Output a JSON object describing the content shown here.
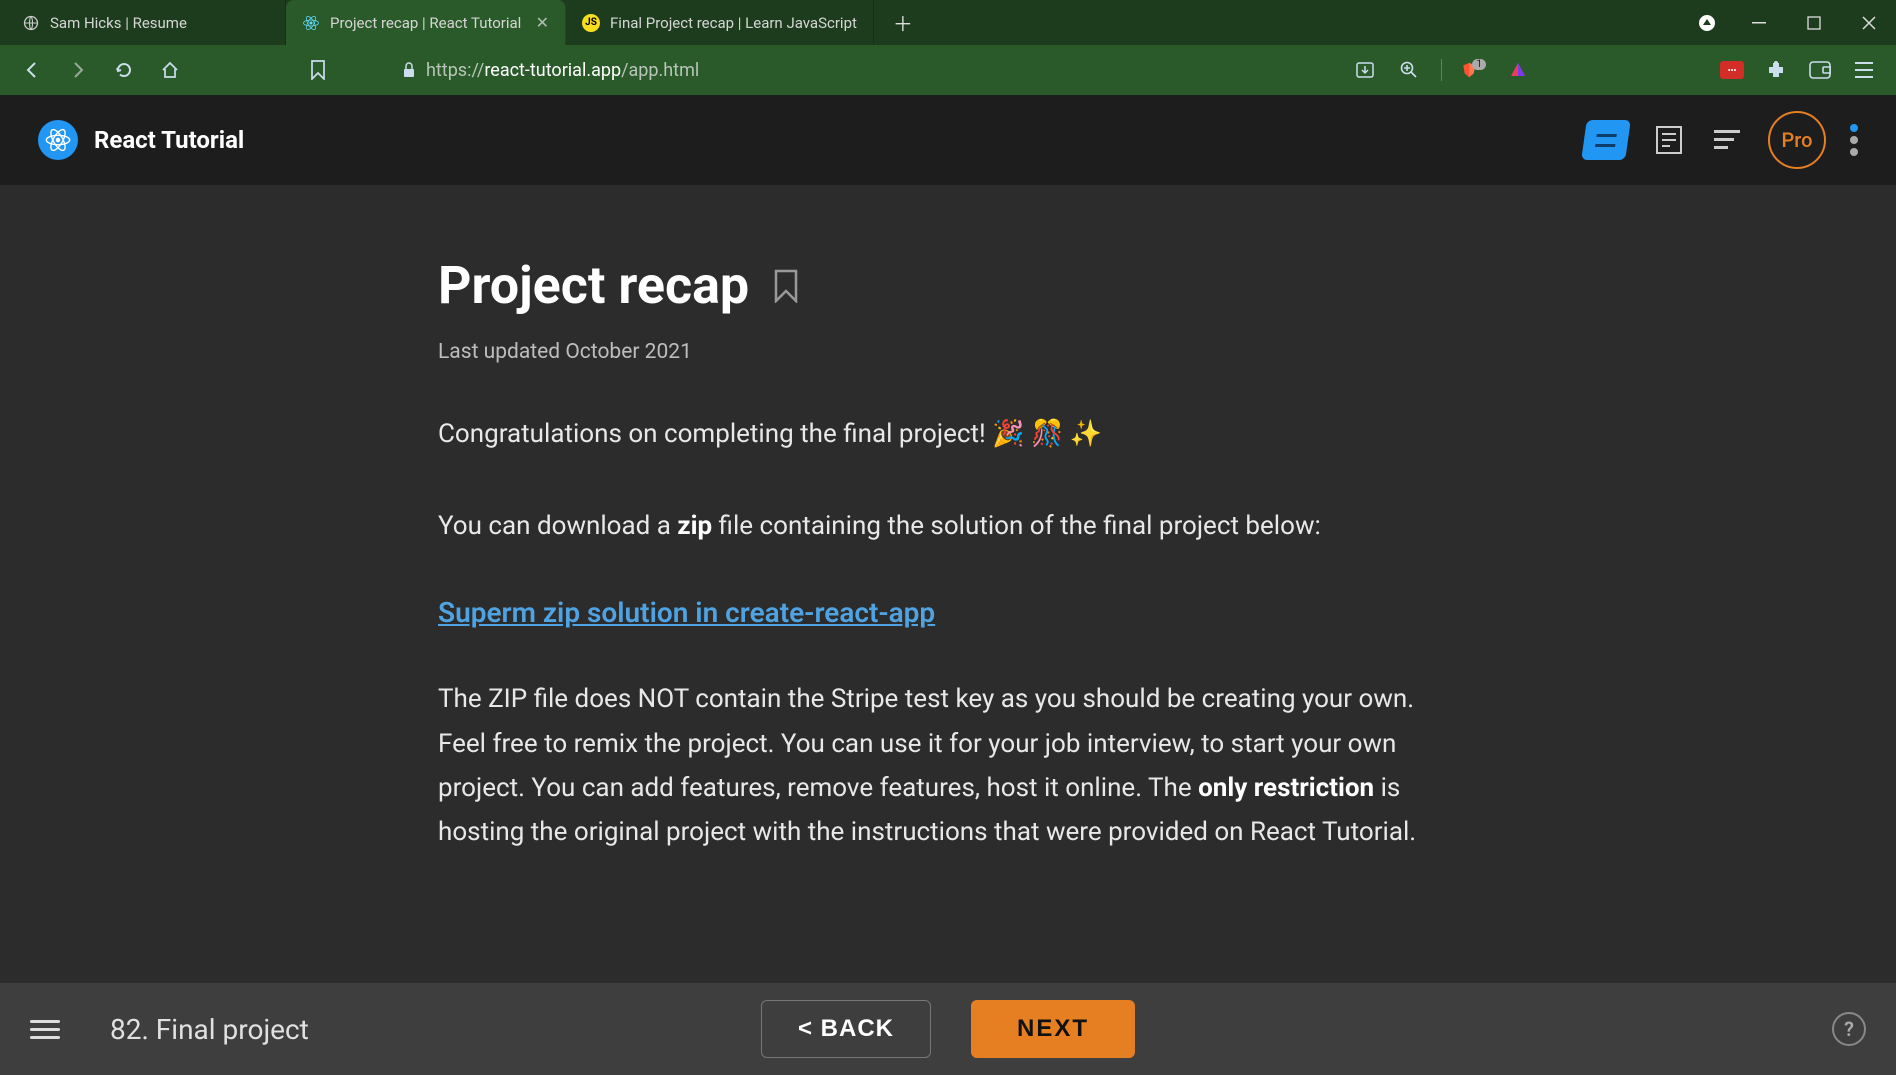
{
  "browser": {
    "tabs": [
      {
        "title": "Sam Hicks | Resume",
        "active": false
      },
      {
        "title": "Project recap | React Tutorial",
        "active": true
      },
      {
        "title": "Final Project recap | Learn JavaScript",
        "active": false
      }
    ],
    "url_prefix": "https://",
    "url_host": "react-tutorial.app",
    "url_path": "/app.html",
    "shield_count": "1"
  },
  "header": {
    "app_title": "React Tutorial",
    "pro_label": "Pro"
  },
  "page": {
    "title": "Project recap",
    "last_updated": "Last updated October 2021",
    "p1_a": "Congratulations on completing the final project! ",
    "p1_emoji": "🎉 🎊 ✨",
    "p2_a": "You can download a ",
    "p2_zip": "zip",
    "p2_b": " file containing the solution of the final project below:",
    "link1": "Superm zip solution in create-react-app",
    "p3_a": "The ZIP file does NOT contain the Stripe test key as you should be creating your own. Feel free to remix the project. You can use it for your job interview, to start your own project. You can add features, remove features, host it online. The ",
    "p3_only": "only restriction",
    "p3_b": " is hosting the original project with the instructions that were provided on React Tutorial."
  },
  "footer": {
    "section": "82. Final project",
    "back": "<  BACK",
    "next": "NEXT"
  }
}
